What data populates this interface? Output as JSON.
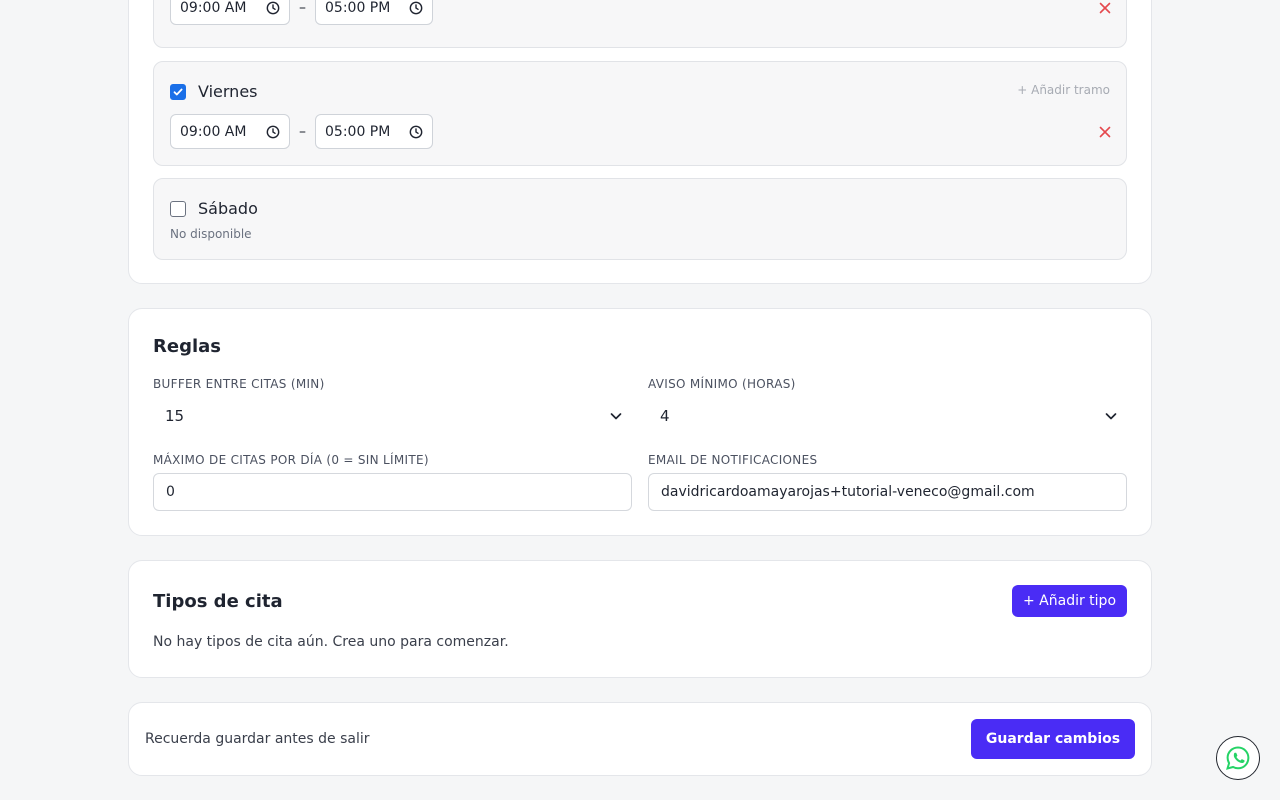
{
  "schedule": {
    "days": [
      {
        "name": "",
        "checked": true,
        "add_slot_label": "",
        "slots": [
          {
            "start": "09:00 AM",
            "end": "05:00 PM"
          }
        ]
      },
      {
        "name": "Viernes",
        "checked": true,
        "add_slot_label": "+ Añadir tramo",
        "slots": [
          {
            "start": "09:00 AM",
            "end": "05:00 PM"
          }
        ]
      },
      {
        "name": "Sábado",
        "checked": false,
        "unavailable_label": "No disponible"
      }
    ],
    "dash": "–"
  },
  "rules": {
    "title": "Reglas",
    "buffer_label": "BUFFER ENTRE CITAS (MIN)",
    "buffer_value": "15",
    "notice_label": "AVISO MÍNIMO (HORAS)",
    "notice_value": "4",
    "max_label": "MÁXIMO DE CITAS POR DÍA (0 = SIN LÍMITE)",
    "max_value": "0",
    "email_label": "EMAIL DE NOTIFICACIONES",
    "email_value": "davidricardoamayarojas+tutorial-veneco@gmail.com"
  },
  "types": {
    "title": "Tipos de cita",
    "add_label": "+ Añadir tipo",
    "empty_text": "No hay tipos de cita aún. Crea uno para comenzar."
  },
  "save_bar": {
    "reminder": "Recuerda guardar antes de salir",
    "save_label": "Guardar cambios"
  },
  "colors": {
    "primary": "#4a2cf5",
    "checkbox": "#1a6fe8",
    "remove": "#e5484d",
    "whatsapp": "#25d366"
  },
  "icons": {
    "clock": "clock-icon",
    "remove": "close-icon",
    "chevron": "chevron-down-icon",
    "whatsapp": "whatsapp-icon"
  }
}
